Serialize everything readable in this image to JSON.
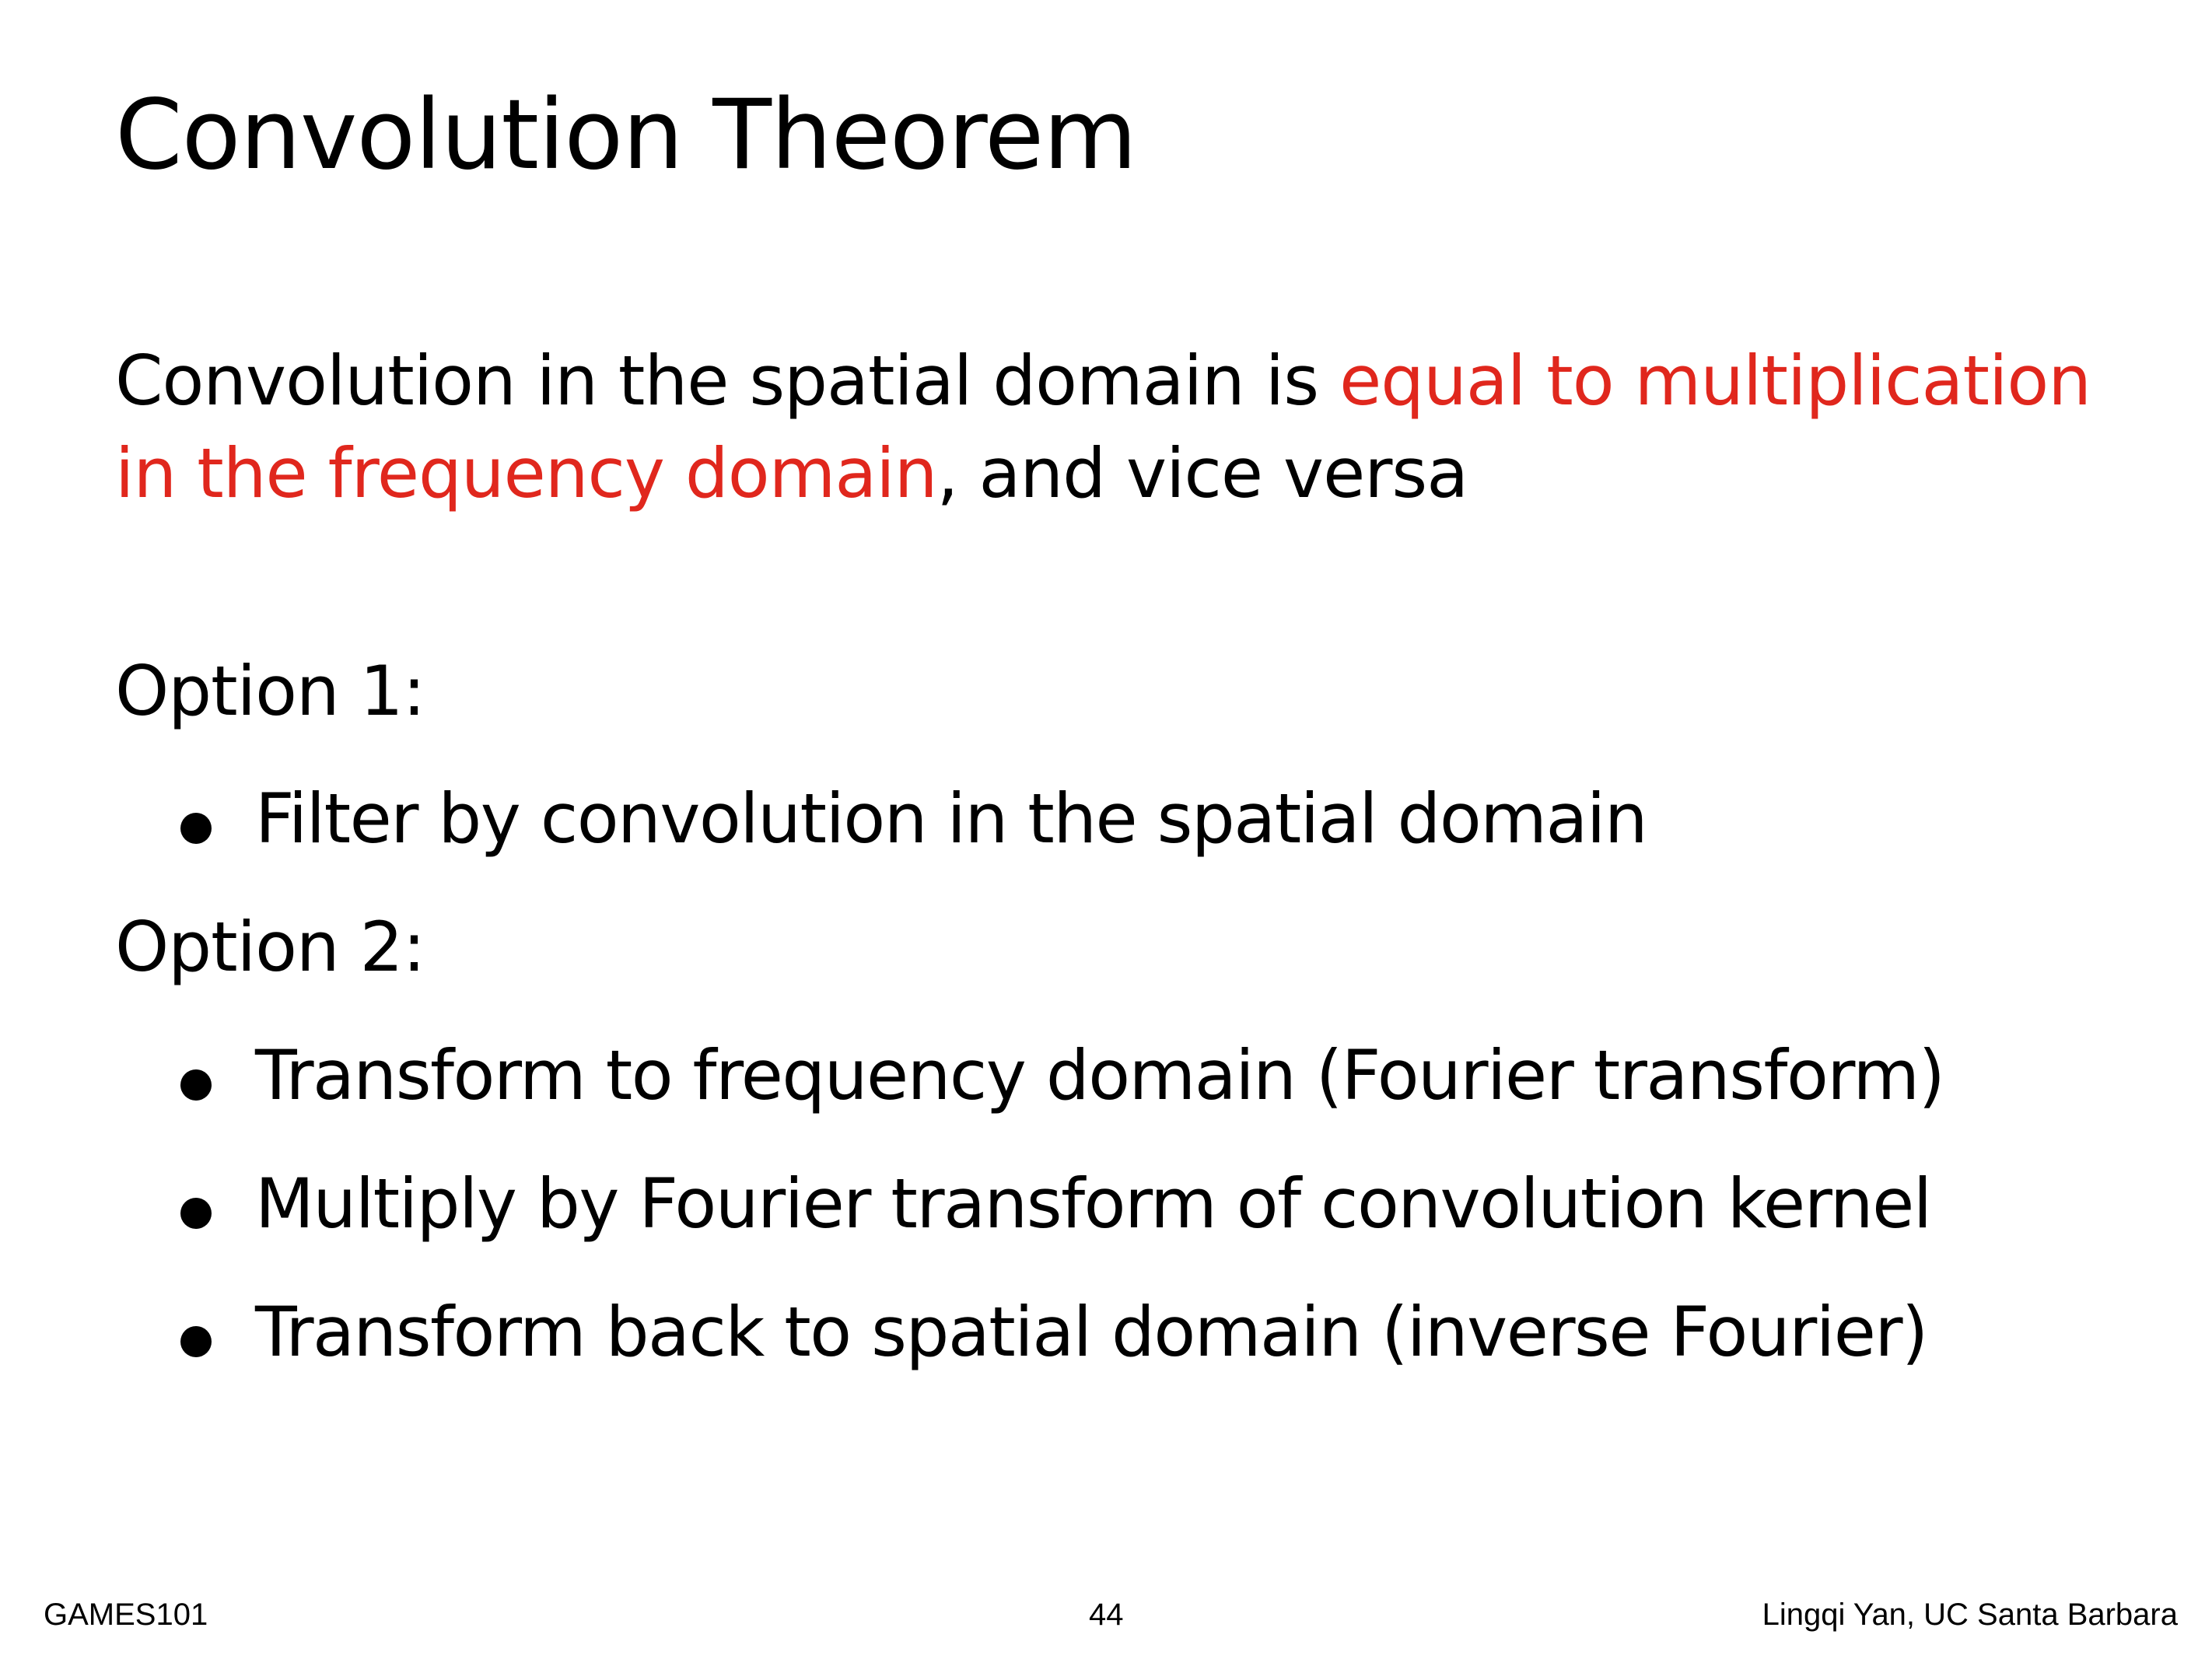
{
  "colors": {
    "text": "#000000",
    "accent": "#e0271d",
    "background": "#ffffff"
  },
  "slide": {
    "title": "Convolution Theorem",
    "statement": {
      "part1": "Convolution in the spatial domain is ",
      "highlight": "equal to multiplication in the frequency domain",
      "part2": ", and vice versa"
    },
    "option1": {
      "label": "Option 1:",
      "bullets": [
        "Filter by convolution in the spatial domain"
      ]
    },
    "option2": {
      "label": "Option 2:",
      "bullets": [
        "Transform to frequency domain (Fourier transform)",
        "Multiply by Fourier transform of convolution kernel",
        "Transform back to spatial domain (inverse Fourier)"
      ]
    }
  },
  "footer": {
    "course": "GAMES101",
    "page_number": "44",
    "author": "Lingqi Yan, UC Santa Barbara"
  }
}
